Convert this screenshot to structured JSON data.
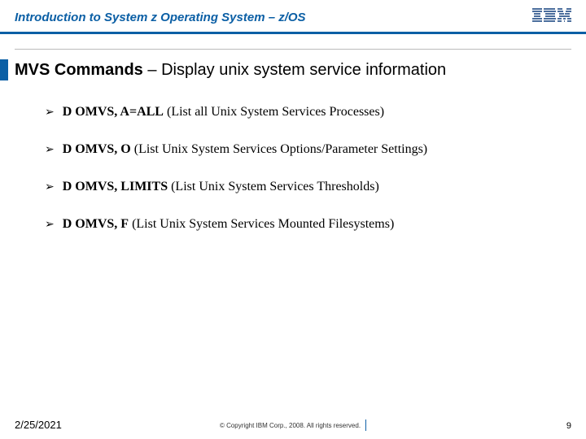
{
  "header": {
    "title": "Introduction to System z Operating System – z/OS",
    "logo_name": "IBM"
  },
  "slide": {
    "title_bold": "MVS Commands",
    "title_sep": " – ",
    "title_rest": "Display unix system service information"
  },
  "items": [
    {
      "cmd": "D OMVS, A=ALL",
      "desc": "  (List all Unix System Services Processes)"
    },
    {
      "cmd": "D OMVS, O",
      "desc": "  (List Unix System Services Options/Parameter Settings)"
    },
    {
      "cmd": "D OMVS, LIMITS",
      "desc": "  (List Unix System Services Thresholds)"
    },
    {
      "cmd": "D OMVS, F",
      "desc": "  (List Unix System Services Mounted Filesystems)"
    }
  ],
  "footer": {
    "date": "2/25/2021",
    "copyright": "© Copyright IBM Corp., 2008. All rights reserved.",
    "page": "9"
  }
}
